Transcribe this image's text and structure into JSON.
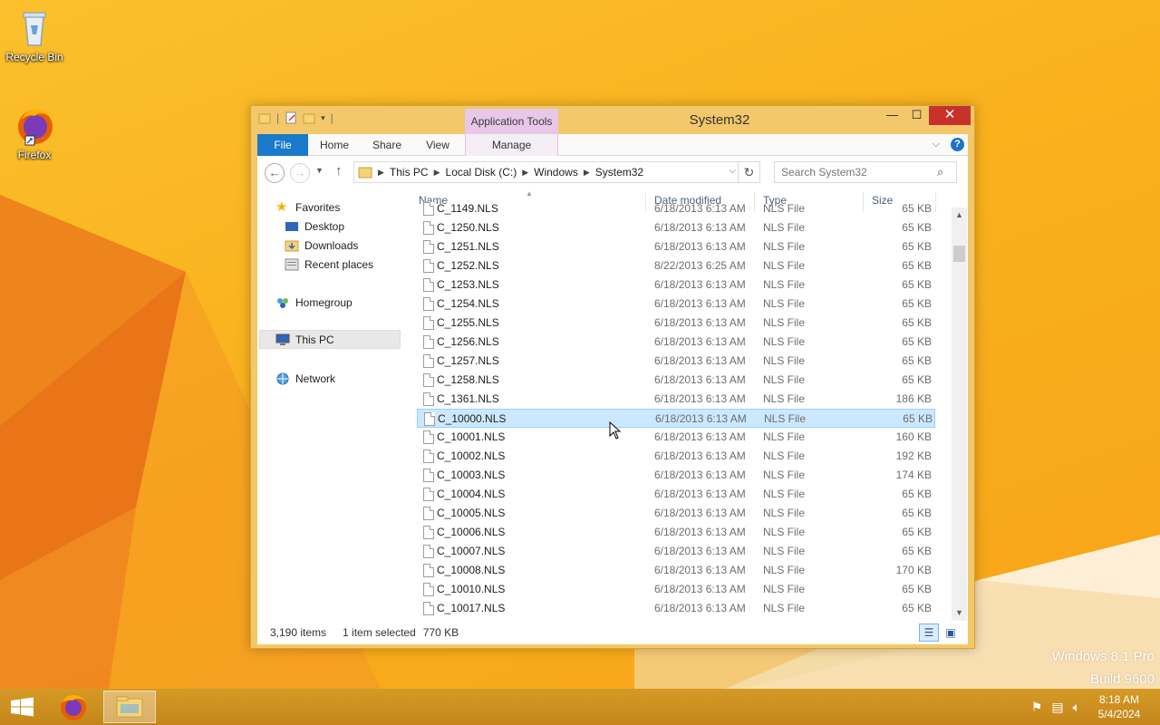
{
  "desktop": {
    "icons": [
      {
        "label": "Recycle Bin",
        "icon": "recycle-bin-icon"
      },
      {
        "label": "Firefox",
        "icon": "firefox-icon"
      }
    ],
    "watermark": {
      "line1": "Windows 8.1 Pro",
      "line2": "Build 9600"
    }
  },
  "window": {
    "title": "System32",
    "context_tab_group": "Application Tools",
    "controls": {
      "minimize": "—",
      "maximize": "☐",
      "close": "✕"
    },
    "ribbon_tabs": [
      "File",
      "Home",
      "Share",
      "View",
      "Manage"
    ],
    "address": {
      "segments": [
        "This PC",
        "Local Disk (C:)",
        "Windows",
        "System32"
      ]
    },
    "search_placeholder": "Search System32",
    "nav_pane": {
      "favorites": "Favorites",
      "favorite_items": [
        "Desktop",
        "Downloads",
        "Recent places"
      ],
      "homegroup": "Homegroup",
      "this_pc": "This PC",
      "network": "Network"
    },
    "columns": {
      "name": "Name",
      "date": "Date modified",
      "type": "Type",
      "size": "Size"
    },
    "files": [
      {
        "name": "C_1149.NLS",
        "date": "6/18/2013 6:13 AM",
        "type": "NLS File",
        "size": "65 KB"
      },
      {
        "name": "C_1250.NLS",
        "date": "6/18/2013 6:13 AM",
        "type": "NLS File",
        "size": "65 KB"
      },
      {
        "name": "C_1251.NLS",
        "date": "6/18/2013 6:13 AM",
        "type": "NLS File",
        "size": "65 KB"
      },
      {
        "name": "C_1252.NLS",
        "date": "8/22/2013 6:25 AM",
        "type": "NLS File",
        "size": "65 KB"
      },
      {
        "name": "C_1253.NLS",
        "date": "6/18/2013 6:13 AM",
        "type": "NLS File",
        "size": "65 KB"
      },
      {
        "name": "C_1254.NLS",
        "date": "6/18/2013 6:13 AM",
        "type": "NLS File",
        "size": "65 KB"
      },
      {
        "name": "C_1255.NLS",
        "date": "6/18/2013 6:13 AM",
        "type": "NLS File",
        "size": "65 KB"
      },
      {
        "name": "C_1256.NLS",
        "date": "6/18/2013 6:13 AM",
        "type": "NLS File",
        "size": "65 KB"
      },
      {
        "name": "C_1257.NLS",
        "date": "6/18/2013 6:13 AM",
        "type": "NLS File",
        "size": "65 KB"
      },
      {
        "name": "C_1258.NLS",
        "date": "6/18/2013 6:13 AM",
        "type": "NLS File",
        "size": "65 KB"
      },
      {
        "name": "C_1361.NLS",
        "date": "6/18/2013 6:13 AM",
        "type": "NLS File",
        "size": "186 KB"
      },
      {
        "name": "C_10000.NLS",
        "date": "6/18/2013 6:13 AM",
        "type": "NLS File",
        "size": "65 KB",
        "selected": true
      },
      {
        "name": "C_10001.NLS",
        "date": "6/18/2013 6:13 AM",
        "type": "NLS File",
        "size": "160 KB"
      },
      {
        "name": "C_10002.NLS",
        "date": "6/18/2013 6:13 AM",
        "type": "NLS File",
        "size": "192 KB"
      },
      {
        "name": "C_10003.NLS",
        "date": "6/18/2013 6:13 AM",
        "type": "NLS File",
        "size": "174 KB"
      },
      {
        "name": "C_10004.NLS",
        "date": "6/18/2013 6:13 AM",
        "type": "NLS File",
        "size": "65 KB"
      },
      {
        "name": "C_10005.NLS",
        "date": "6/18/2013 6:13 AM",
        "type": "NLS File",
        "size": "65 KB"
      },
      {
        "name": "C_10006.NLS",
        "date": "6/18/2013 6:13 AM",
        "type": "NLS File",
        "size": "65 KB"
      },
      {
        "name": "C_10007.NLS",
        "date": "6/18/2013 6:13 AM",
        "type": "NLS File",
        "size": "65 KB"
      },
      {
        "name": "C_10008.NLS",
        "date": "6/18/2013 6:13 AM",
        "type": "NLS File",
        "size": "170 KB"
      },
      {
        "name": "C_10010.NLS",
        "date": "6/18/2013 6:13 AM",
        "type": "NLS File",
        "size": "65 KB"
      },
      {
        "name": "C_10017.NLS",
        "date": "6/18/2013 6:13 AM",
        "type": "NLS File",
        "size": "65 KB"
      }
    ],
    "status": {
      "items": "3,190 items",
      "selected": "1 item selected",
      "size": "770 KB"
    }
  },
  "taskbar": {
    "clock": {
      "time": "8:18 AM",
      "date": "5/4/2024"
    },
    "tray_icons": [
      "flag-icon",
      "network-icon",
      "volume-icon"
    ]
  },
  "colors": {
    "accent": "#1979ca",
    "selection": "#cce8ff",
    "taskbar": "#c78a1c",
    "window_frame": "#f2c86a"
  }
}
